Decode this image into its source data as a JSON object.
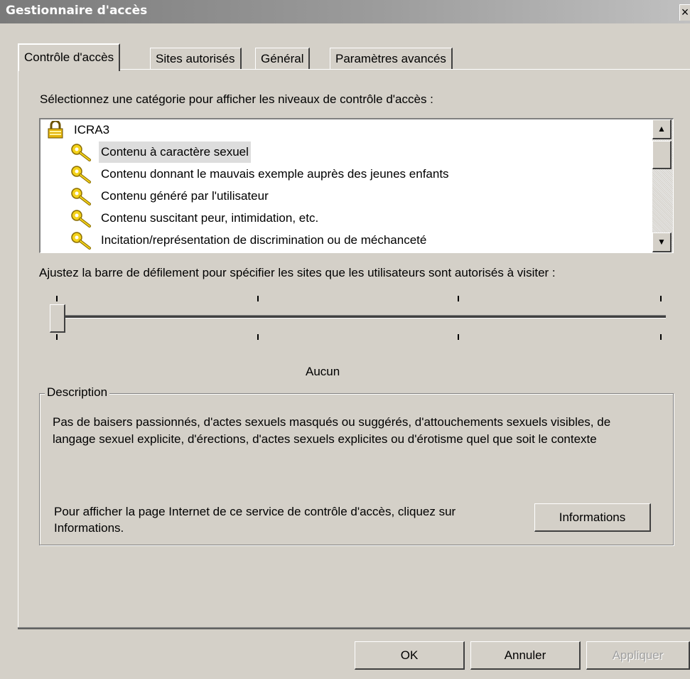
{
  "window": {
    "title": "Gestionnaire d'accès",
    "close_label": "×"
  },
  "tabs": [
    {
      "label": "Contrôle d'accès",
      "active": true
    },
    {
      "label": "Sites autorisés",
      "active": false
    },
    {
      "label": "Général",
      "active": false
    },
    {
      "label": "Paramètres avancés",
      "active": false
    }
  ],
  "categories": {
    "instruction": "Sélectionnez une catégorie pour afficher les niveaux de contrôle d'accès :",
    "root": {
      "label": "ICRA3",
      "icon": "lock-folder-icon"
    },
    "items": [
      {
        "label": "Contenu à caractère sexuel",
        "icon": "key-icon",
        "selected": true
      },
      {
        "label": "Contenu donnant le mauvais exemple auprès des jeunes enfants",
        "icon": "key-icon"
      },
      {
        "label": "Contenu généré par l'utilisateur",
        "icon": "key-icon"
      },
      {
        "label": "Contenu suscitant peur, intimidation, etc.",
        "icon": "key-icon"
      },
      {
        "label": "Incitation/représentation de discrimination ou de méchanceté",
        "icon": "key-icon"
      }
    ]
  },
  "slider": {
    "instruction": "Ajustez la barre de défilement pour spécifier les sites que les utilisateurs sont autorisés à visiter :",
    "level_label": "Aucun",
    "position": 0,
    "steps": 4
  },
  "description": {
    "legend": "Description",
    "text": "Pas de baisers passionnés, d'actes sexuels masqués ou suggérés, d'attouchements sexuels visibles, de langage sexuel explicite, d'érections, d'actes sexuels explicites ou d'érotisme quel que soit le contexte",
    "info_text": "Pour afficher la page Internet de ce service de contrôle d'accès, cliquez sur Informations.",
    "info_button": "Informations"
  },
  "footer": {
    "ok": "OK",
    "cancel": "Annuler",
    "apply": "Appliquer"
  },
  "colors": {
    "dialog_bg": "#d4d0c8",
    "title_gradient_start": "#7a7a7a",
    "selection_bg": "#dddddd"
  }
}
